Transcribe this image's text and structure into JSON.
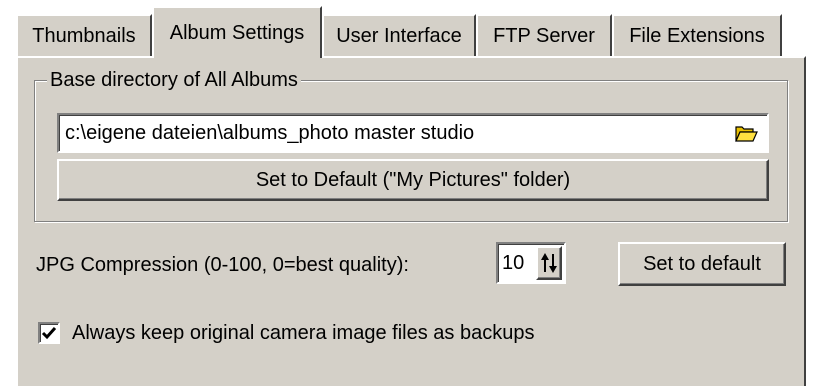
{
  "tabs": [
    {
      "label": "Thumbnails"
    },
    {
      "label": "Album Settings"
    },
    {
      "label": "User Interface"
    },
    {
      "label": "FTP Server"
    },
    {
      "label": "File Extensions"
    }
  ],
  "active_tab": "Album Settings",
  "base_dir": {
    "legend": "Base directory of All Albums",
    "value": "c:\\eigene dateien\\albums_photo master studio",
    "browse_icon": "folder-open-icon",
    "default_button": "Set to Default (\"My Pictures\" folder)"
  },
  "jpg": {
    "label": "JPG Compression (0-100, 0=best quality):",
    "value": "10",
    "spin_icon": "up-down-arrows-icon",
    "reset_button": "Set to default"
  },
  "backup": {
    "checked": true,
    "label": "Always keep original camera image files as backups"
  },
  "colors": {
    "face": "#d4d0c8",
    "highlight": "#ffffff",
    "shadow": "#808080",
    "dark_shadow": "#404040",
    "folder": "#e8c000"
  }
}
